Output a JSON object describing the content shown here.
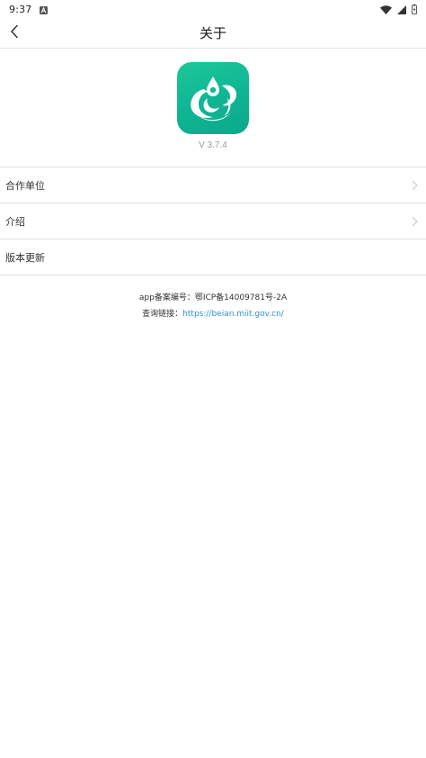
{
  "status_bar": {
    "time": "9:37",
    "icons": [
      "notification-a-icon",
      "wifi-icon",
      "signal-icon",
      "battery-icon"
    ]
  },
  "header": {
    "title": "关于",
    "back_icon": "back-arrow-icon"
  },
  "app": {
    "logo_icon": "app-logo-icon",
    "version": "V 3.7.4",
    "brand_color": "#12bb95"
  },
  "menu": {
    "items": [
      {
        "label": "合作单位",
        "has_chevron": true
      },
      {
        "label": "介绍",
        "has_chevron": true
      },
      {
        "label": "版本更新",
        "has_chevron": false
      }
    ]
  },
  "footer": {
    "record_line": "app备案编号：鄂ICP备14009781号-2A",
    "query_prefix": "查询链接：",
    "query_link": "https://beian.miit.gov.cn/",
    "link_color": "#2f8fd6"
  }
}
